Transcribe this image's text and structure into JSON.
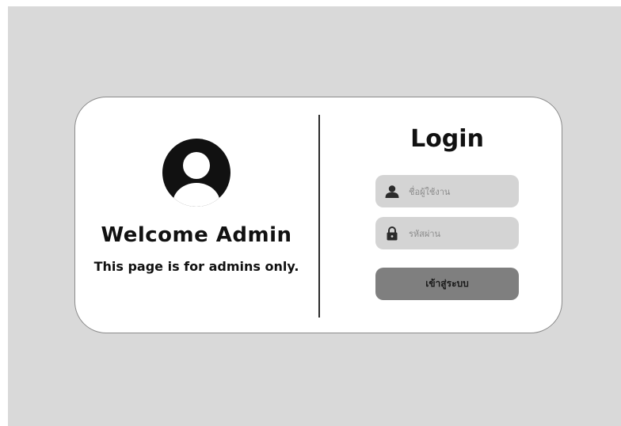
{
  "welcome": {
    "title": "Welcome Admin",
    "subtitle": "This page is for admins only."
  },
  "login": {
    "title": "Login",
    "username_placeholder": "ชื่อผู้ใช้งาน",
    "password_placeholder": "รหัสผ่าน",
    "submit_label": "เข้าสู่ระบบ"
  },
  "icons": {
    "avatar": "user-avatar-icon",
    "username": "user-icon",
    "password": "lock-icon"
  },
  "colors": {
    "background": "#d9d9d9",
    "card": "#ffffff",
    "field": "#d4d4d4",
    "button": "#7f7f7f",
    "text": "#111111"
  }
}
